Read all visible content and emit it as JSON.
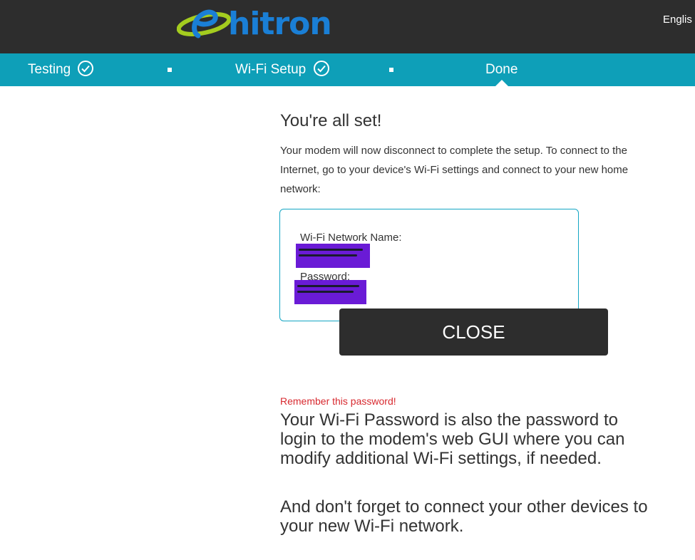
{
  "header": {
    "logo_text": "hitron",
    "language": "Englis"
  },
  "steps": [
    {
      "label": "Testing",
      "completed": true
    },
    {
      "label": "Wi-Fi Setup",
      "completed": true
    },
    {
      "label": "Done",
      "completed": false,
      "active": true
    }
  ],
  "main": {
    "heading": "You're all set!",
    "intro": "Your modem will now disconnect to complete the setup. To connect to the Internet, go to your device's Wi-Fi settings and connect to your new home network:",
    "network_label": "Wi-Fi Network Name:",
    "password_label": "Password:",
    "close_label": "CLOSE",
    "remember": "Remember this password!",
    "password_note": "Your Wi-Fi Password is also the password to login to the modem's web GUI where you can modify additional Wi-Fi settings, if needed.",
    "devices_note": "And don't forget to connect your other devices to your new Wi-Fi network."
  },
  "colors": {
    "header_bg": "#2d2d2d",
    "stepbar_bg": "#0e9fb8",
    "box_border": "#14a6c4",
    "redaction": "#6a1bd6",
    "warning": "#d8292f"
  }
}
